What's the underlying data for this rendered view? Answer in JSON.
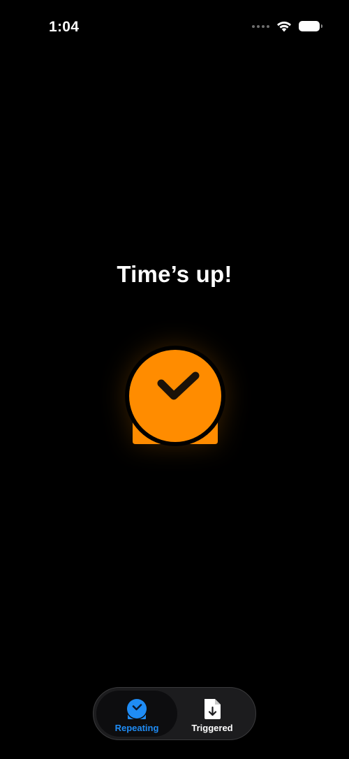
{
  "status_bar": {
    "time": "1:04",
    "icons": [
      "cellular-dots-icon",
      "wifi-icon",
      "battery-icon"
    ]
  },
  "main": {
    "headline": "Time’s up!",
    "hero_icon": "alarm-checkmark-icon"
  },
  "tab_bar": {
    "tabs": [
      {
        "label": "Repeating",
        "icon": "alarm-checkmark-icon",
        "selected": true
      },
      {
        "label": "Triggered",
        "icon": "document-download-icon",
        "selected": false
      }
    ]
  },
  "colors": {
    "background": "#000000",
    "accent_orange": "#ff8c00",
    "selected_tab_blue": "#1f8cf5",
    "text": "#ffffff"
  }
}
